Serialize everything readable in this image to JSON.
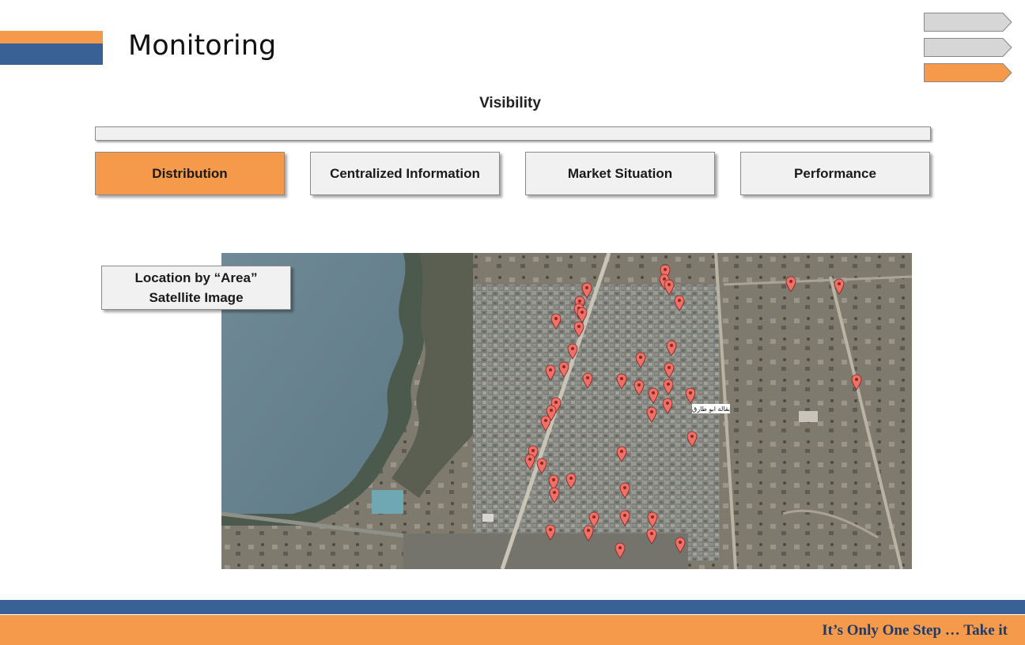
{
  "header": {
    "title": "Monitoring"
  },
  "colors": {
    "orange": "#f59a4a",
    "blue": "#3a6195",
    "panel": "#f1f1f1",
    "water": "#6f8a96",
    "marker": "#f07068"
  },
  "steps": [
    {
      "state": "inactive"
    },
    {
      "state": "inactive"
    },
    {
      "state": "active"
    }
  ],
  "section": {
    "title": "Visibility"
  },
  "tabs": [
    {
      "label": "Distribution",
      "active": true
    },
    {
      "label": "Centralized Information",
      "active": false
    },
    {
      "label": "Market Situation",
      "active": false
    },
    {
      "label": "Performance",
      "active": false
    }
  ],
  "callout": {
    "line1": "Location by “Area”",
    "line2": "Satellite Image"
  },
  "map": {
    "place_label": "بقالة ابو طارق",
    "marker_icon": "map-pin-icon"
  },
  "footer": {
    "tagline": "It’s Only One Step … Take it"
  }
}
